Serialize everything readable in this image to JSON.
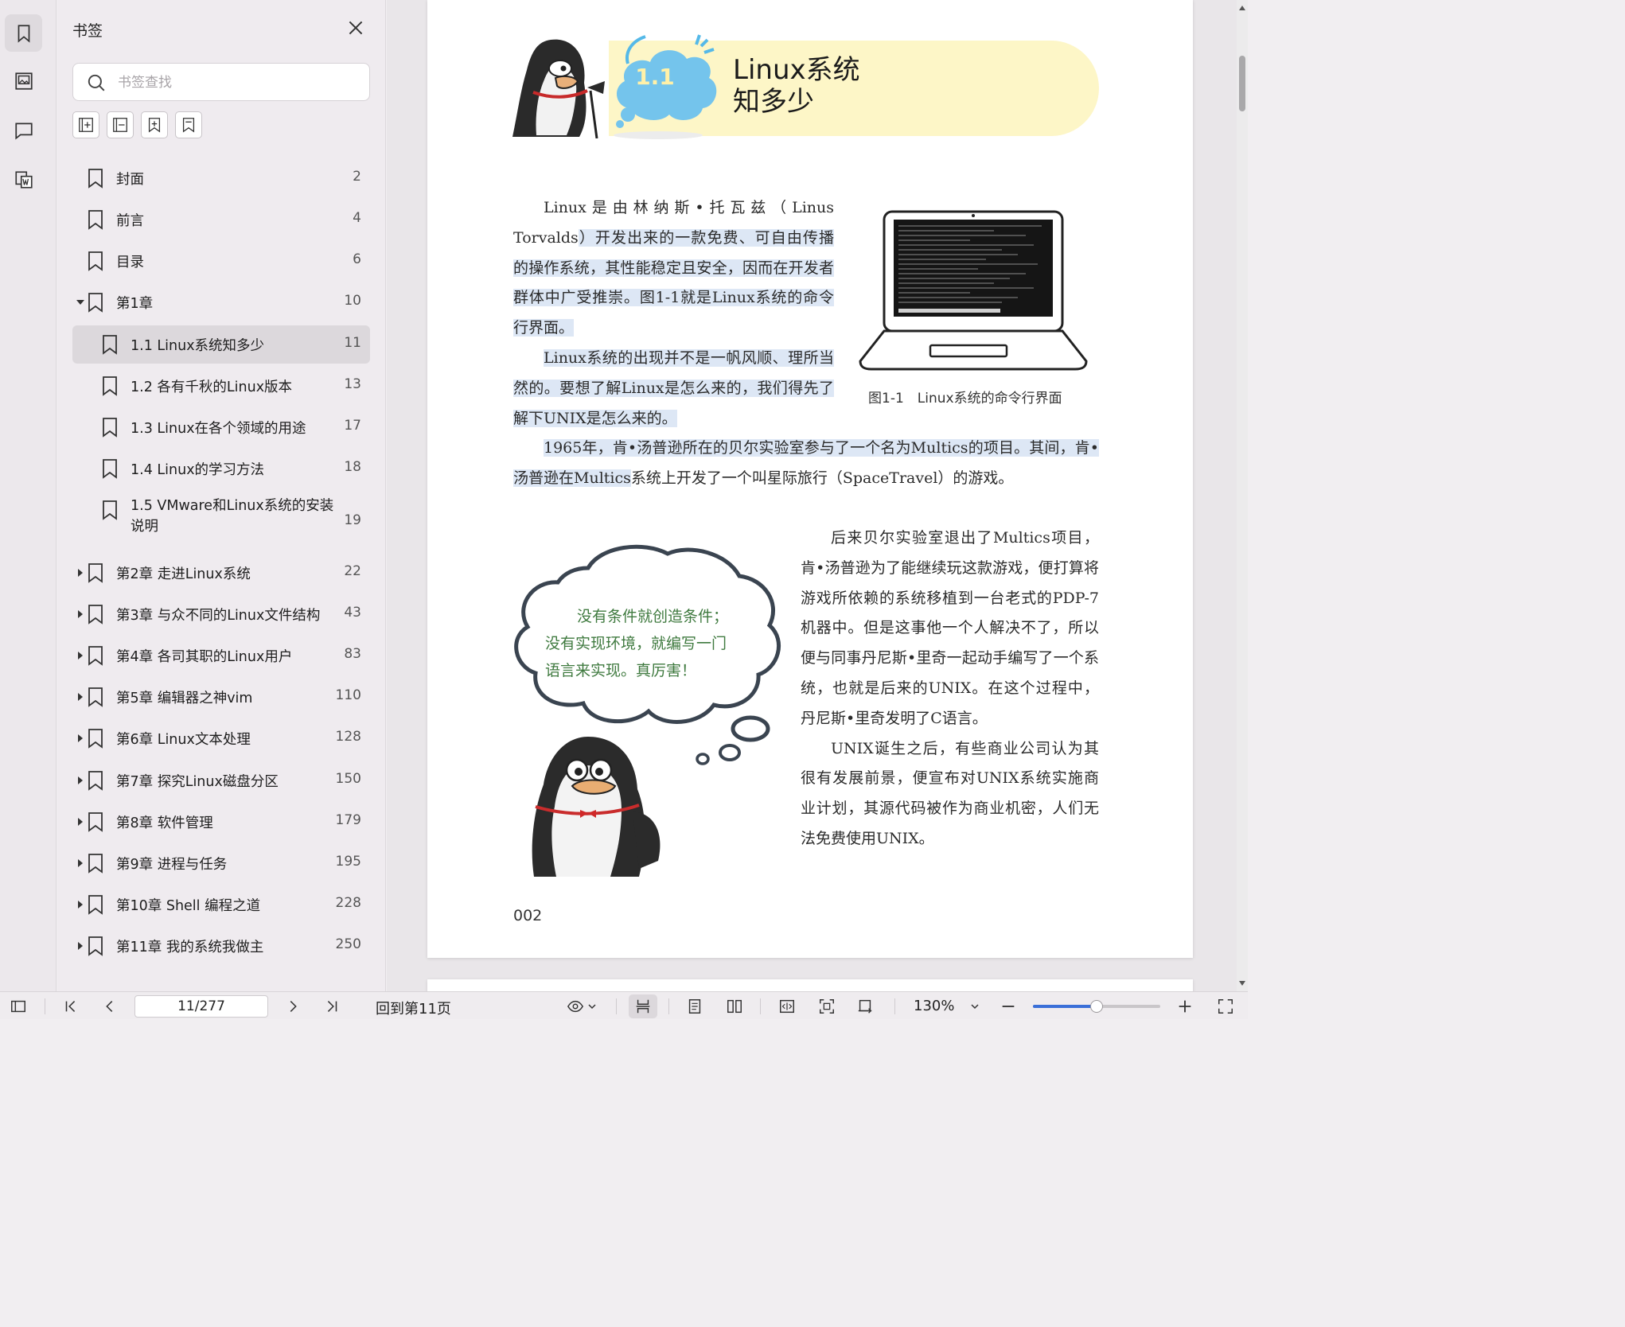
{
  "sidebar": {
    "title": "书签",
    "search": {
      "placeholder": "书签查找",
      "value": ""
    },
    "bookmarks": [
      {
        "label": "封面",
        "page": "2"
      },
      {
        "label": "前言",
        "page": "4"
      },
      {
        "label": "目录",
        "page": "6"
      },
      {
        "label": "第1章",
        "page": "10",
        "expanded": true
      },
      {
        "label": "1.1 Linux系统知多少",
        "page": "11",
        "selected": true
      },
      {
        "label": "1.2 各有千秋的Linux版本",
        "page": "13"
      },
      {
        "label": "1.3 Linux在各个领域的用途",
        "page": "17"
      },
      {
        "label": "1.4 Linux的学习方法",
        "page": "18"
      },
      {
        "label": "1.5 VMware和Linux系统的安装",
        "label2": "说明",
        "page": "19"
      },
      {
        "label": "第2章 走进Linux系统",
        "page": "22"
      },
      {
        "label": "第3章 与众不同的Linux文件结构",
        "page": "43"
      },
      {
        "label": "第4章 各司其职的Linux用户",
        "page": "83"
      },
      {
        "label": "第5章 编辑器之神vim",
        "page": "110"
      },
      {
        "label": "第6章 Linux文本处理",
        "page": "128"
      },
      {
        "label": "第7章 探究Linux磁盘分区",
        "page": "150"
      },
      {
        "label": "第8章 软件管理",
        "page": "179"
      },
      {
        "label": "第9章 进程与任务",
        "page": "195"
      },
      {
        "label": "第10章 Shell 编程之道",
        "page": "228"
      },
      {
        "label": "第11章 我的系统我做主",
        "page": "250"
      }
    ]
  },
  "document": {
    "section_number": "1.1",
    "section_title_line1": "Linux系统",
    "section_title_line2": "知多少",
    "para1": {
      "lead": "Linux是由林纳斯•托瓦兹（Linus Torvalds",
      "highlight": "）开发出来的一款免费、可自由传播的操作系统，其性能稳定且安全，因而在开发者群体中广受推崇。图1-1就是Linux系统的命令行界面。",
      "second": "Linux系统的出现并不是一帆风顺、理所当然的。要想了解Linux是怎么来的，我们得先了解下UNIX是怎么来的。"
    },
    "para2": {
      "highlight": "1965年，肯•汤普逊所在的贝尔实验室参与了一个名为Multics的项目。其间，肯•汤普逊在Multics",
      "rest": "系统上开发了一个叫星际旅行（SpaceTravel）的游戏。"
    },
    "para3": {
      "p1": "后来贝尔实验室退出了Multics项目，肯•汤普逊为了能继续玩这款游戏，便打算将游戏所依赖的系统移植到一台老式的PDP-7机器中。但是这事他一个人解决不了，所以便与同事丹尼斯•里奇一起动手编写了一个系统，也就是后来的UNIX。在这个过程中，丹尼斯•里奇发明了C语言。",
      "p2": "UNIX诞生之后，有些商业公司认为其很有发展前景，便宣布对UNIX系统实施商业计划，其源代码被作为商业机密，人们无法免费使用UNIX。"
    },
    "figure_caption": "图1-1　Linux系统的命令行界面",
    "thought_bubble": [
      "没有条件就创造条件；",
      "没有实现环境，就编写一门",
      "语言来实现。真厉害！"
    ],
    "page_number": "002"
  },
  "toolbar": {
    "page_indicator": "11/277",
    "goto_label": "回到第11页",
    "zoom": "130%",
    "zoom_fraction": 0.5
  },
  "colors": {
    "accent": "#3a6fd8",
    "highlight": "#dde7f5",
    "banner": "#fdf6c7",
    "thought_text": "#3f7a3f"
  }
}
